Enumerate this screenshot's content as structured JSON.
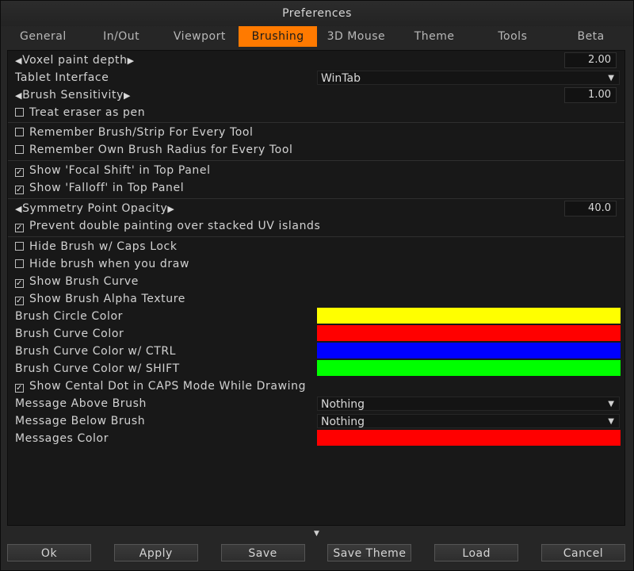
{
  "window": {
    "title": "Preferences"
  },
  "tabs": [
    {
      "label": "General"
    },
    {
      "label": "In/Out"
    },
    {
      "label": "Viewport"
    },
    {
      "label": "Brushing",
      "active": true
    },
    {
      "label": "3D Mouse"
    },
    {
      "label": "Theme"
    },
    {
      "label": "Tools"
    },
    {
      "label": "Beta"
    }
  ],
  "settings": {
    "voxel_paint_depth": {
      "label": "Voxel paint depth",
      "value": "2.00"
    },
    "tablet_interface": {
      "label": "Tablet Interface",
      "value": "WinTab"
    },
    "brush_sensitivity": {
      "label": "Brush Sensitivity",
      "value": "1.00"
    },
    "treat_eraser": {
      "label": "Treat eraser as pen",
      "checked": false
    },
    "remember_brush_strip": {
      "label": "Remember Brush/Strip For Every Tool",
      "checked": false
    },
    "remember_brush_radius": {
      "label": "Remember Own Brush Radius for Every Tool",
      "checked": false
    },
    "show_focal_shift": {
      "label": "Show 'Focal Shift' in Top Panel",
      "checked": true
    },
    "show_falloff": {
      "label": "Show 'Falloff' in Top Panel",
      "checked": true
    },
    "symmetry_point_opacity": {
      "label": "Symmetry Point Opacity",
      "value": "40.0"
    },
    "prevent_double_painting": {
      "label": "Prevent double painting over stacked UV islands",
      "checked": true
    },
    "hide_brush_caps": {
      "label": "Hide Brush w/ Caps Lock",
      "checked": false
    },
    "hide_brush_draw": {
      "label": "Hide brush when you draw",
      "checked": false
    },
    "show_brush_curve": {
      "label": "Show Brush Curve",
      "checked": true
    },
    "show_brush_alpha": {
      "label": "Show Brush Alpha Texture",
      "checked": true
    },
    "brush_circle_color": {
      "label": "Brush Circle Color",
      "color": "#ffff00"
    },
    "brush_curve_color": {
      "label": "Brush Curve Color",
      "color": "#ff0000"
    },
    "brush_curve_color_ctrl": {
      "label": "Brush Curve Color w/ CTRL",
      "color": "#0000ff"
    },
    "brush_curve_color_shift": {
      "label": "Brush Curve Color w/ SHIFT",
      "color": "#00ff00"
    },
    "show_central_dot": {
      "label": "Show Cental Dot in CAPS Mode While Drawing",
      "checked": true
    },
    "message_above_brush": {
      "label": "Message Above Brush",
      "value": "Nothing"
    },
    "message_below_brush": {
      "label": "Message Below Brush",
      "value": "Nothing"
    },
    "messages_color": {
      "label": "Messages Color",
      "color": "#ff0000"
    }
  },
  "buttons": {
    "ok": "Ok",
    "apply": "Apply",
    "save": "Save",
    "save_theme": "Save Theme",
    "load": "Load",
    "cancel": "Cancel"
  },
  "glyphs": {
    "arrow_left": "◀",
    "arrow_right": "▶",
    "caret": "▼",
    "check": "✓",
    "scroll_down": "▼"
  },
  "colors": {
    "accent": "#ff7a00"
  }
}
